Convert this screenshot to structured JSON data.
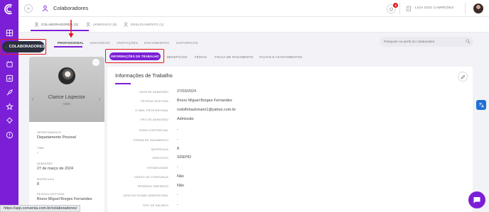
{
  "app": {
    "brand_color": "#7b1fd6",
    "alert_color": "#e2181e"
  },
  "sidebar": {
    "active_label": "COLABORADORES",
    "icons": [
      "home-icon",
      "building-icon",
      "dashboard-icon",
      "rocket-icon",
      "star-icon",
      "lightbulb-icon",
      "help-icon"
    ]
  },
  "header": {
    "collapse_symbol": "»",
    "title": "Colaboradores",
    "notification_count": "4",
    "company_name": "LIGA DOS CAMPEÕES"
  },
  "top_tabs": [
    {
      "label": "COLABORADORES (2)",
      "active": true
    },
    {
      "label": "ADMISSÃO (8)",
      "active": false
    },
    {
      "label": "DESLIGAMENTO (1)",
      "active": false
    }
  ],
  "sub_tabs": [
    {
      "label": "PROFISSIONAL",
      "active": true
    },
    {
      "label": "ADICIONAIS",
      "active": false
    },
    {
      "label": "ANOTAÇÕES",
      "active": false
    },
    {
      "label": "DOCUMENTOS",
      "active": false
    },
    {
      "label": "HISTÓRICOS",
      "active": false
    }
  ],
  "search": {
    "placeholder": "Pesquise no perfil do colaborador"
  },
  "profile": {
    "more_symbol": "···",
    "name": "Clarice Lispector",
    "role": "CEO",
    "fields": [
      {
        "label": "DEPARTAMENTO",
        "value": "Departamento Pessoal"
      },
      {
        "label": "TIME",
        "value": "-"
      },
      {
        "label": "ADMISSÃO",
        "value": "27 de março de 2024"
      },
      {
        "label": "MATRÍCULA",
        "value": "8"
      },
      {
        "label": "PESSOA GESTORA",
        "value": "Bruno Miguel Borges Fernandes"
      }
    ]
  },
  "info_tabs": [
    {
      "label": "INFORMAÇÕES DE TRABALHO",
      "active": true
    },
    {
      "label": "BENEFÍCIOS",
      "active": false
    },
    {
      "label": "FÉRIAS",
      "active": false
    },
    {
      "label": "FOLHA DE PAGAMENTO",
      "active": false
    },
    {
      "label": "FALTAS E AFASTAMENTOS",
      "active": false
    }
  ],
  "panel": {
    "title": "Informações de Trabalho",
    "rows": [
      {
        "label": "DATA DE ADMISSÃO",
        "value": "27/03/2024"
      },
      {
        "label": "PESSOA GESTORA",
        "value": "Bruno Miguel Borges Fernandes"
      },
      {
        "label": "E-MAIL PROFISSIONAL",
        "value": "rodolfohackmann1@yahoo.com.br"
      },
      {
        "label": "TIPO DE ADMISSÃO",
        "value": "Admissão"
      },
      {
        "label": "HORA CONTRATUAL",
        "value": "-"
      },
      {
        "label": "FORMA DE PAGAMENTO",
        "value": "-"
      },
      {
        "label": "MATRÍCULA",
        "value": "8"
      },
      {
        "label": "SINDICATO",
        "value": "SDEPID"
      },
      {
        "label": "ESTABILIDADE",
        "value": "-"
      },
      {
        "label": "CARGO DE CONFIANÇA",
        "value": "Não"
      },
      {
        "label": "PRIMEIRO EMPREGO",
        "value": "Não"
      },
      {
        "label": "DATA DO EXAME ADMISSIONAL",
        "value": "-"
      },
      {
        "label": "TIPO DE SALÁRIO",
        "value": "-"
      }
    ]
  },
  "status_bar": {
    "url": "https://app.convenia.com.br/colaboradores/"
  }
}
